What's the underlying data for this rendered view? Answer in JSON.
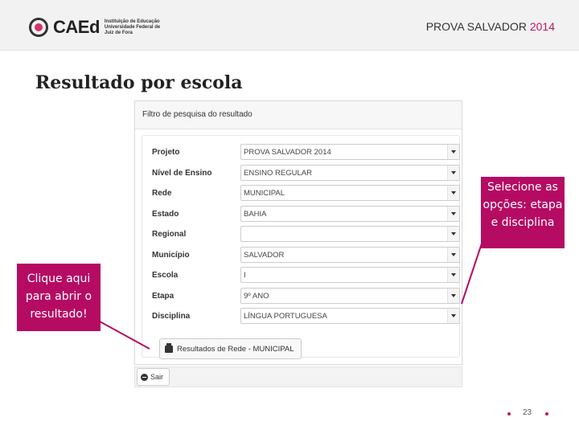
{
  "header": {
    "logo_text": "CAEd",
    "logo_subtitle": "Instituição de Educação Universidade Federal de Juiz de Fora",
    "title_main": "PROVA SALVADOR ",
    "title_year": "2014"
  },
  "page_title": "Resultado por escola",
  "panel": {
    "heading": "Filtro de pesquisa do resultado",
    "fields": [
      {
        "label": "Projeto",
        "value": "PROVA SALVADOR 2014"
      },
      {
        "label": "Nível de Ensino",
        "value": "ENSINO REGULAR"
      },
      {
        "label": "Rede",
        "value": "MUNICIPAL"
      },
      {
        "label": "Estado",
        "value": "BAHIA"
      },
      {
        "label": "Regional",
        "value": ""
      },
      {
        "label": "Município",
        "value": "SALVADOR"
      },
      {
        "label": "Escola",
        "value": "I"
      },
      {
        "label": "Etapa",
        "value": "9º ANO"
      },
      {
        "label": "Disciplina",
        "value": "LÍNGUA PORTUGUESA"
      }
    ],
    "result_button": "Resultados de Rede - MUNICIPAL",
    "exit_button": "Sair"
  },
  "callouts": {
    "left": "Clique aqui para abrir o resultado!",
    "right": "Selecione as opções: etapa e disciplina"
  },
  "footer": {
    "page_number": "23"
  },
  "colors": {
    "accent": "#b50b63",
    "header_bg": "#f2f2f2"
  },
  "icons": {
    "logo": "caed-logo-icon",
    "printer": "printer-icon",
    "exit": "exit-icon",
    "dropdown": "chevron-down-icon"
  }
}
